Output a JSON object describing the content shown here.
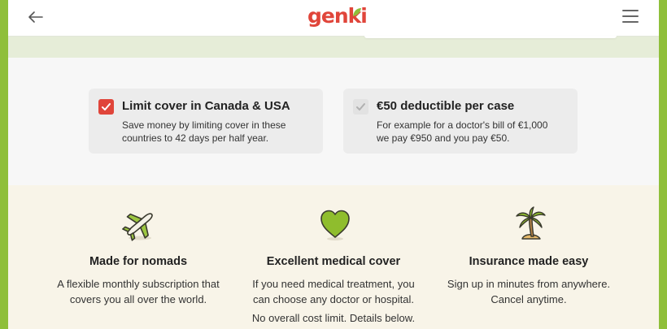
{
  "header": {
    "logo_text": "genki",
    "back_icon": "arrow-left-icon",
    "menu_icon": "hamburger-menu-icon",
    "brand_color": "#e0453a",
    "leaf_color": "#8fbf3a"
  },
  "options": [
    {
      "title": "Limit cover in Canada & USA",
      "desc_line1": "Save money by limiting cover in these",
      "desc_line2": "countries to 42 days per half year.",
      "checked": true
    },
    {
      "title": "€50 deductible per case",
      "desc_line1": "For example for a doctor's bill of €1,000",
      "desc_line2": "we pay €950 and you pay €50.",
      "checked": false
    }
  ],
  "benefits": [
    {
      "icon": "airplane-icon",
      "title": "Made for nomads",
      "desc_line1": "A flexible monthly subscription that",
      "desc_line2": "covers you all over the world."
    },
    {
      "icon": "heart-icon",
      "title": "Excellent medical cover",
      "desc_line1": "If you need medical treatment, you",
      "desc_line2": "can choose any doctor or hospital.",
      "extra": "No overall cost limit. Details below."
    },
    {
      "icon": "palm-tree-icon",
      "title": "Insurance made easy",
      "desc_line1": "Sign up in minutes from anywhere.",
      "desc_line2": "Cancel anytime."
    }
  ]
}
